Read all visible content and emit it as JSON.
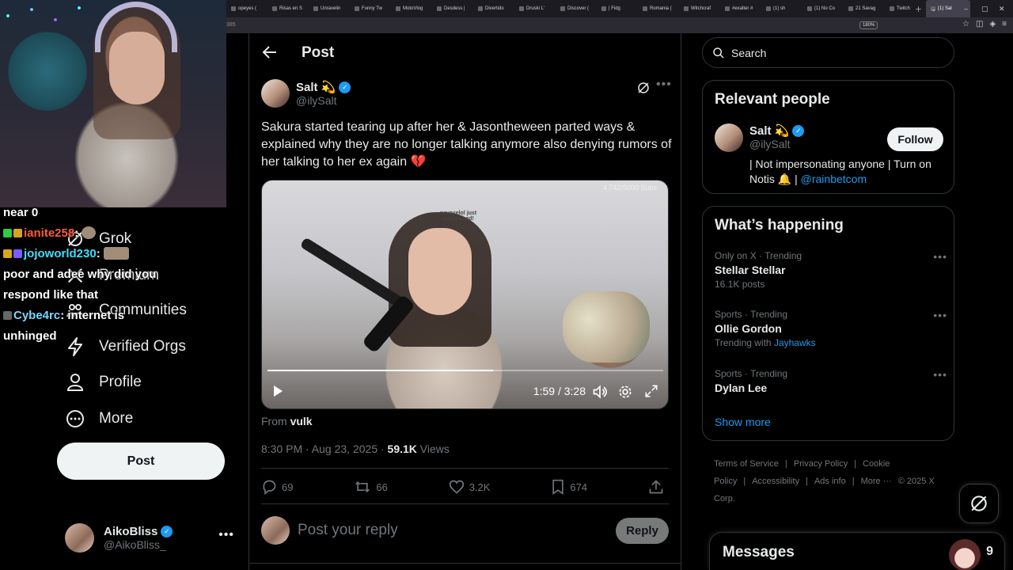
{
  "browser": {
    "tabs": [
      "opeyes (",
      "Risas en S",
      "Unravelin",
      "Funny Tw",
      "MotoVlog",
      "Desdess |",
      "Divertido",
      "Druski L'",
      "Discover (",
      "| Fidg",
      "Romania (",
      "Witchcraf",
      "#exalter #",
      "(1) sh",
      "(1) No Co",
      "21 Savag",
      "Twitch",
      "(1) Sal"
    ],
    "zoom": "180%",
    "url_fragment": "385"
  },
  "leftnav": {
    "items": [
      {
        "label": "Grok",
        "icon": "grok-icon"
      },
      {
        "label": "Premium",
        "icon": "x-logo-icon"
      },
      {
        "label": "Communities",
        "icon": "communities-icon"
      },
      {
        "label": "Verified Orgs",
        "icon": "lightning-icon"
      },
      {
        "label": "Profile",
        "icon": "person-icon"
      },
      {
        "label": "More",
        "icon": "more-circle-icon"
      }
    ],
    "post_button": "Post",
    "account": {
      "name": "AikoBliss",
      "handle": "@AikoBliss_"
    }
  },
  "chat": {
    "lines": [
      {
        "user": "",
        "text": "near 0"
      },
      {
        "user": "ianite258",
        "text": ":"
      },
      {
        "user": "jojoworld230",
        "text": ":"
      },
      {
        "user": "",
        "text": "poor and adee why did you respond like that"
      },
      {
        "user": "Cybe4rc",
        "text": ": internet is unhinged"
      }
    ]
  },
  "main": {
    "header_title": "Post",
    "author": {
      "name": "Salt 💫",
      "handle": "@ilySalt"
    },
    "text": "Sakura started tearing up after her & Jasontheween parted ways & explained why they are no longer talking anymore also denying rumors of her talking to her ex again 💔",
    "video": {
      "time": "1:59 / 3:28",
      "progress": 0.57,
      "overlay_sub": "navayelol just subscribed!",
      "overlay_count": "4,742/5000 Subs"
    },
    "from_label": "From",
    "from_name": "vulk",
    "timestamp": "8:30 PM · Aug 23, 2025 · ",
    "views_count": "59.1K",
    "views_label": " Views",
    "actions": {
      "replies": "69",
      "reposts": "66",
      "likes": "3.2K",
      "bookmarks": "674"
    },
    "reply_placeholder": "Post your reply",
    "reply_button": "Reply"
  },
  "right": {
    "search_placeholder": "Search",
    "relevant": {
      "title": "Relevant people",
      "name": "Salt 💫",
      "handle": "@ilySalt",
      "follow": "Follow",
      "bio_prefix": "| Not impersonating anyone | Turn on Notis 🔔 | ",
      "bio_link": "@rainbetcom"
    },
    "happening": {
      "title": "What’s happening",
      "trends": [
        {
          "category": "Only on X · Trending",
          "name": "Stellar Stellar",
          "count": "16.1K posts"
        },
        {
          "category": "Sports · Trending",
          "name": "Ollie Gordon",
          "count_prefix": "Trending with ",
          "count_link": "Jayhawks"
        },
        {
          "category": "Sports · Trending",
          "name": "Dylan Lee"
        }
      ],
      "show_more": "Show more"
    },
    "footer": {
      "links": [
        "Terms of Service",
        "|",
        "Privacy Policy",
        "|",
        "Cookie Policy",
        "|",
        "Accessibility",
        "|",
        "Ads info",
        "|",
        "More ···",
        "© 2025 X Corp."
      ]
    },
    "messages": {
      "title": "Messages",
      "count": "9"
    }
  },
  "colors": {
    "accent": "#1d9bf0",
    "bg": "#000000",
    "border": "#2f3336",
    "muted": "#71767b"
  }
}
